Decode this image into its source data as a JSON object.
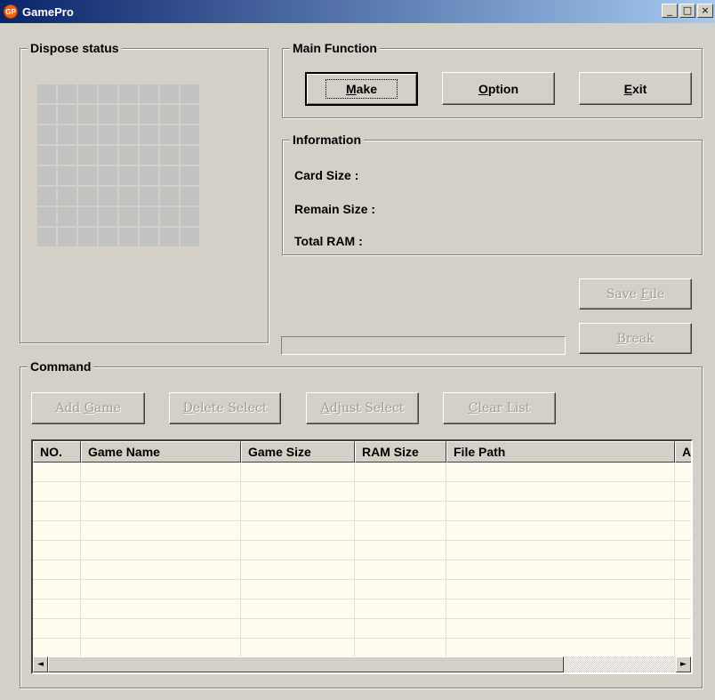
{
  "window": {
    "title": "GamePro",
    "icon": "gamepro-logo-icon",
    "icon_text": "GP"
  },
  "titlebar_buttons": {
    "minimize": "_",
    "maximize": "□",
    "close": "×"
  },
  "dispose": {
    "label": "Dispose status",
    "grid_rows": 8,
    "grid_cols": 8
  },
  "main_function": {
    "label": "Main Function",
    "make": {
      "pre": "",
      "key": "M",
      "post": "ake"
    },
    "option": {
      "pre": "",
      "key": "O",
      "post": "ption"
    },
    "exit": {
      "pre": "",
      "key": "E",
      "post": "xit"
    }
  },
  "information": {
    "label": "Information",
    "card_size": "Card Size :",
    "remain_size": "Remain Size :",
    "total_ram": "Total RAM :"
  },
  "save_file": {
    "pre": "Save ",
    "key": "F",
    "post": "ile"
  },
  "break_btn": {
    "pre": "",
    "key": "B",
    "post": "reak"
  },
  "command": {
    "label": "Command",
    "add_game": {
      "pre": "Add ",
      "key": "G",
      "post": "ame"
    },
    "delete_select": {
      "pre": "",
      "key": "D",
      "post": "elete Select"
    },
    "adjust_select": {
      "pre": "",
      "key": "A",
      "post": "djust Select"
    },
    "clear_list": {
      "pre": "",
      "key": "C",
      "post": "lear List"
    }
  },
  "table": {
    "columns": [
      "NO.",
      "Game Name",
      "Game Size",
      "RAM Size",
      "File Path",
      "Ad"
    ],
    "rows": 10
  },
  "scrollbar": {
    "left_arrow": "◄",
    "right_arrow": "►"
  },
  "colors": {
    "face": "#d4d0c8",
    "titlebar_start": "#0a246a",
    "titlebar_end": "#a6caf0",
    "list_bg": "#fffdf0",
    "disabled_text": "#a09c96"
  }
}
